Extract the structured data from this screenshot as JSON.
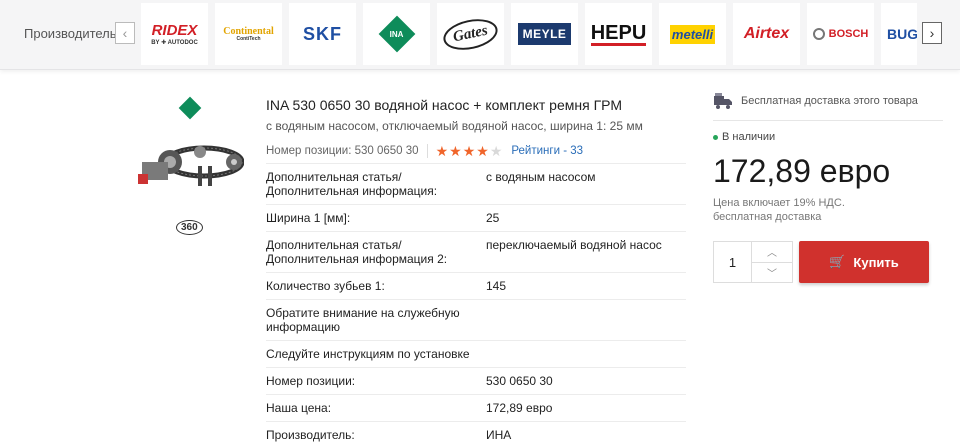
{
  "brandbar": {
    "label": "Производитель",
    "prev_icon": "chevron-left-icon",
    "next_icon": "chevron-right-icon",
    "brands": [
      {
        "name": "RIDEX",
        "sub": "BY ✚ AUTODOC",
        "cls": "ridex"
      },
      {
        "name": "Continental",
        "sub": "ContiTech",
        "cls": "conti"
      },
      {
        "name": "SKF",
        "sub": "",
        "cls": "skf"
      },
      {
        "name": "INA",
        "sub": "",
        "cls": "ina"
      },
      {
        "name": "Gates",
        "sub": "",
        "cls": "gates"
      },
      {
        "name": "MEYLE",
        "sub": "",
        "cls": "meyle"
      },
      {
        "name": "HEPU",
        "sub": "",
        "cls": "hepu"
      },
      {
        "name": "metelli",
        "sub": "",
        "cls": "metelli"
      },
      {
        "name": "Airtex",
        "sub": "",
        "cls": "airtex"
      },
      {
        "name": "BOSCH",
        "sub": "",
        "cls": "bosch"
      },
      {
        "name": "BUG",
        "sub": "",
        "cls": "bugi"
      }
    ]
  },
  "gallery": {
    "badge_360": "360"
  },
  "product": {
    "title": "INA 530 0650 30 водяной насос + комплект ремня ГРМ",
    "subtitle": "с водяным насосом, отключаемый водяной насос, ширина 1: 25 мм",
    "position_number": "Номер позиции: 530 0650 30",
    "rating": 4,
    "rating_max": 5,
    "ratings_link": "Рейтинги - 33"
  },
  "specs": [
    {
      "key": "Дополнительная статья/ Дополнительная информация:",
      "value": "с водяным насосом"
    },
    {
      "key": "Ширина 1 [мм]:",
      "value": "25"
    },
    {
      "key": "Дополнительная статья/ Дополнительная информация 2:",
      "value": "переключаемый водяной насос"
    },
    {
      "key": "Количество зубьев 1:",
      "value": "145"
    },
    {
      "key": "Обратите внимание на служебную информацию",
      "value": ""
    },
    {
      "key": "Следуйте инструкциям по установке",
      "value": ""
    },
    {
      "key": "Номер позиции:",
      "value": "530 0650 30"
    },
    {
      "key": "Наша цена:",
      "value": "172,89 евро"
    },
    {
      "key": "Производитель:",
      "value": "ИНА"
    }
  ],
  "buybox": {
    "shipping": "Бесплатная доставка этого товара",
    "stock": "В наличии",
    "price": "172,89 евро",
    "vat": "Цена включает 19% НДС.",
    "delivery": "бесплатная доставка",
    "quantity": "1",
    "buy_label": "Купить"
  },
  "colors": {
    "accent": "#d0312d",
    "in_stock": "#27a55a",
    "stars": "#f0652b",
    "link": "#2a6db8"
  }
}
